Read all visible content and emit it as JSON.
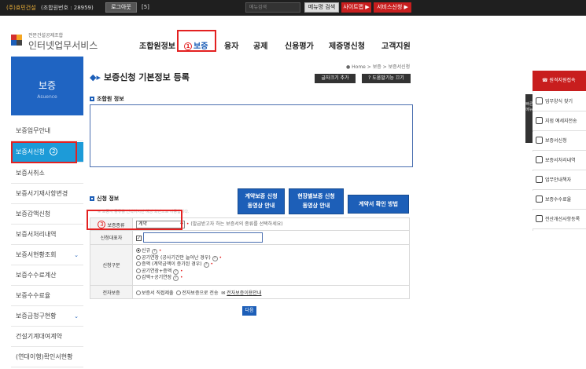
{
  "topbar": {
    "company": "(주)효민건설",
    "union_no": "(조합원번호 : 28959)",
    "logout": "로그아웃",
    "count": "[5]",
    "search_placeholder": "메뉴검색",
    "menu_search": "메뉴명 검색",
    "sitemap": "사이트맵 ▶",
    "service": "서비스신청 ▶"
  },
  "logo": {
    "sub": "전문건설공제조합",
    "main": "인터넷업무서비스"
  },
  "gnb": [
    {
      "label": "조합원정보"
    },
    {
      "label": "보증",
      "badge": "1"
    },
    {
      "label": "융자"
    },
    {
      "label": "공제"
    },
    {
      "label": "신용평가"
    },
    {
      "label": "제증명신청"
    },
    {
      "label": "고객지원"
    }
  ],
  "lnb": {
    "title": "보증",
    "subtitle": "Asuence",
    "items": [
      {
        "label": "보증업무안내"
      },
      {
        "label": "보증서신청",
        "badge": "2"
      },
      {
        "label": "보증서취소"
      },
      {
        "label": "보증서기재사항변경"
      },
      {
        "label": "보증감액신청"
      },
      {
        "label": "보증서처리내역"
      },
      {
        "label": "보증서현황조회",
        "chev": "⌄"
      },
      {
        "label": "보증수수료계산"
      },
      {
        "label": "보증수수료율"
      },
      {
        "label": "보증금청구현황",
        "chev": "⌄"
      },
      {
        "label": "건설기계대여계약"
      },
      {
        "label": "(연대이행)확인서현황"
      }
    ]
  },
  "breadcrumb": "● Home > 보증 > 보증서신청",
  "page_title": "보증신청 기본정보 등록",
  "btn_font_up": "글자크기 추가",
  "btn_help": "? 도움말기능 끄기",
  "section_union": "조합원 정보",
  "section_apply": "신청 정보",
  "blue_buttons": [
    "계약보증 신청\n동영상 안내",
    "현장별보증 신청\n동영상 안내",
    "계약서 확인 방법"
  ],
  "note": "※ 보증서 종류를 선택하시면 해당 화면으로 이동합니다.",
  "form": {
    "type_badge": "3",
    "type_label": "보증종류",
    "type_value": "계약",
    "type_hint": "(발급받고자 하는 보증서의 종류를 선택하세요)",
    "rep_label": "신청대표자",
    "rep_check": "✓",
    "kind_label": "신청구분",
    "kind_options": [
      {
        "label": "신규",
        "on": true
      },
      {
        "label": "공기연장 (공사기간만 늘어난 경우)",
        "on": false
      },
      {
        "label": "증액 (계약금액이 증가된 경우)",
        "on": false
      },
      {
        "label": "공기연장+증액",
        "on": false
      },
      {
        "label": "감액+공기연장",
        "on": false
      }
    ],
    "e_label": "전자보증",
    "e_opt1": "보증서 직접제출",
    "e_opt2": "전자보증으로 전송",
    "e_link": "전자보증이용안내"
  },
  "next_button": "다음",
  "quick": {
    "remote": "원격지원접속",
    "side": "빠른메뉴",
    "items": [
      "업무양식 찾기",
      "지점 예세지전송",
      "보증서신청",
      "보증서처리내역",
      "업무안내책자",
      "보증수수료율",
      "전산개선사항등록"
    ]
  }
}
